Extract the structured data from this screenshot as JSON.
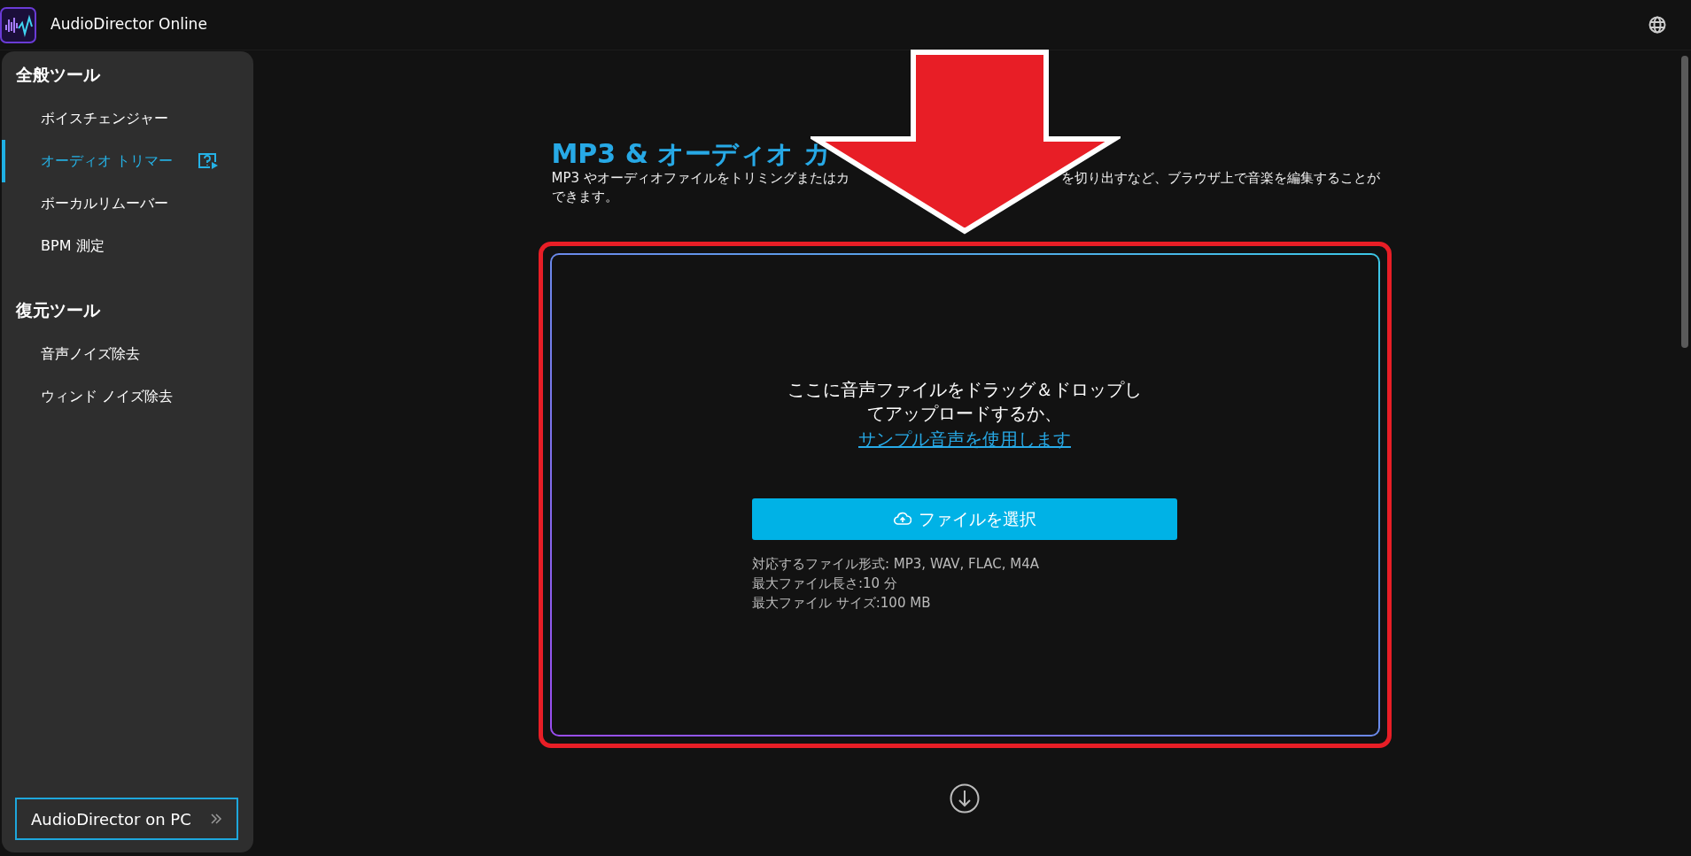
{
  "header": {
    "app_name": "AudioDirector Online"
  },
  "sidebar": {
    "sections": [
      {
        "heading": "全般ツール",
        "items": [
          {
            "label": "ボイスチェンジャー",
            "selected": false,
            "help": false
          },
          {
            "label": "オーディオ トリマー",
            "selected": true,
            "help": true
          },
          {
            "label": "ボーカルリムーバー",
            "selected": false,
            "help": false
          },
          {
            "label": "BPM 測定",
            "selected": false,
            "help": false
          }
        ]
      },
      {
        "heading": "復元ツール",
        "items": [
          {
            "label": "音声ノイズ除去",
            "selected": false,
            "help": false
          },
          {
            "label": "ウィンド ノイズ除去",
            "selected": false,
            "help": false
          }
        ]
      }
    ],
    "pc_button": "AudioDirector on PC"
  },
  "main": {
    "title": "MP3 & オーディオ カ",
    "description": [
      "MP3 やオーディオファイルをトリミングまたはカ",
      "を切り出すなど、ブラウザ上で音楽を編集することが",
      "できます。"
    ],
    "upload": {
      "prompt": "ここに音声ファイルをドラッグ＆ドロップしてアップロードするか、",
      "sample_link": "サンプル音声を使用します",
      "button": "ファイルを選択",
      "info": [
        "対応するファイル形式: MP3, WAV, FLAC, M4A",
        "最大ファイル長さ:10 分",
        "最大ファイル サイズ:100 MB"
      ]
    }
  }
}
